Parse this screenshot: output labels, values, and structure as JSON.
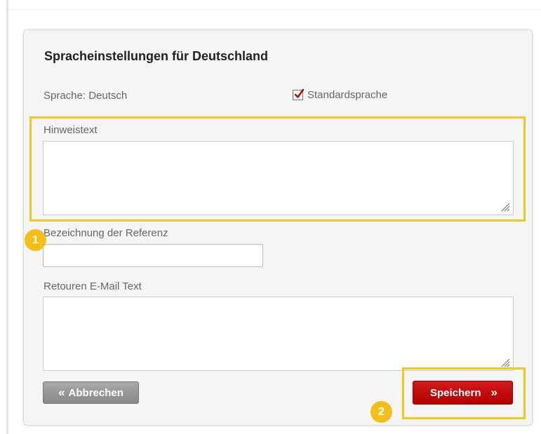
{
  "heading": "Spracheinstellungen für Deutschland",
  "language_label": "Sprache: Deutsch",
  "default_language": {
    "label": "Standardsprache",
    "checked": true
  },
  "fields": {
    "hint_text": {
      "label": "Hinweistext",
      "value": ""
    },
    "reference_name": {
      "label": "Bezeichnung der Referenz",
      "value": ""
    },
    "return_email_text": {
      "label": "Retouren E-Mail Text",
      "value": ""
    }
  },
  "buttons": {
    "cancel": {
      "label": "Abbrechen",
      "icon": "double-chevron-left-icon"
    },
    "save": {
      "label": "Speichern",
      "icon": "double-chevron-right-icon"
    }
  },
  "callouts": [
    "1",
    "2"
  ],
  "colors": {
    "accent_red": "#c00000",
    "highlight_yellow": "#f2c81f",
    "cancel_gray": "#999999"
  }
}
